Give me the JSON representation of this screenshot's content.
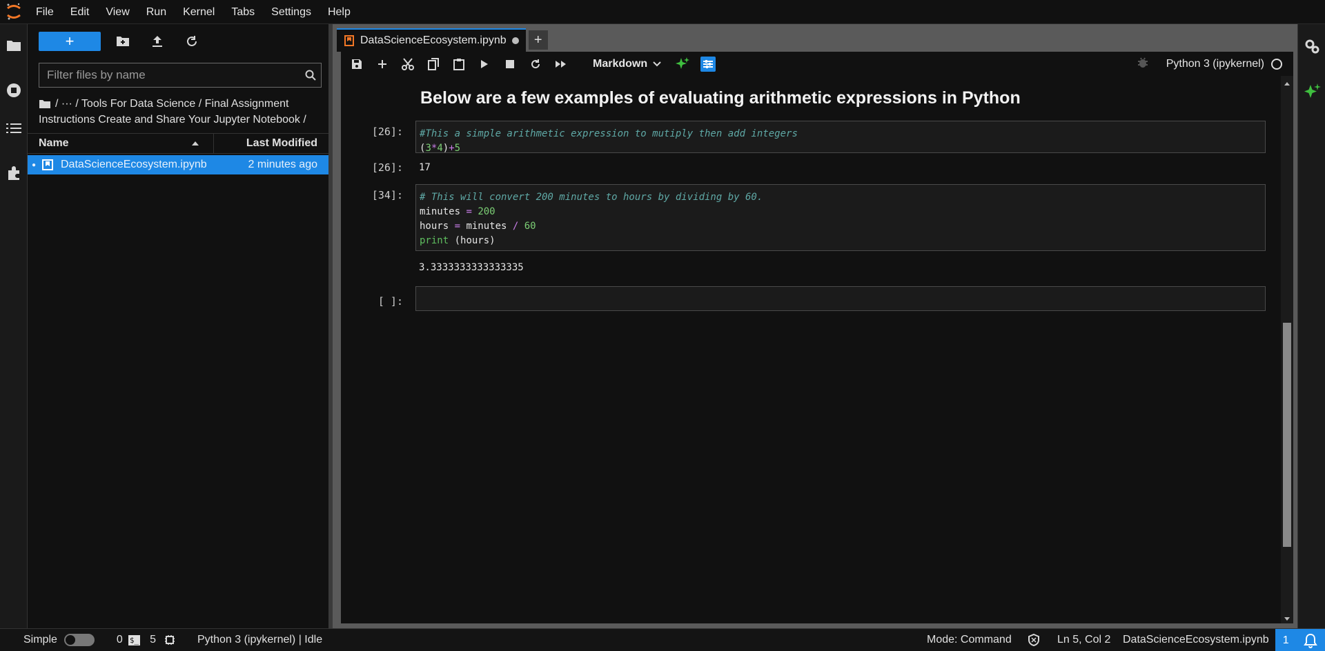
{
  "menu": [
    "File",
    "Edit",
    "View",
    "Run",
    "Kernel",
    "Tabs",
    "Settings",
    "Help"
  ],
  "filebrowser": {
    "new_label": "+",
    "filter_placeholder": "Filter files by name",
    "breadcrumb_line1": "/   ···   / Tools For Data Science / Final Assignment",
    "breadcrumb_line2": "Instructions Create and Share Your Jupyter Notebook /",
    "col_name": "Name",
    "col_modified": "Last Modified",
    "files": [
      {
        "name": "DataScienceEcosystem.ipynb",
        "modified": "2 minutes ago",
        "selected": true
      }
    ]
  },
  "notebook": {
    "tab_title": "DataScienceEcosystem.ipynb",
    "tab_add": "+",
    "cell_type": "Markdown",
    "kernel_name": "Python 3 (ipykernel)",
    "heading": "Below are a few examples of evaluating arithmetic expressions in Python",
    "cells": [
      {
        "prompt": "[26]:",
        "comment": "#This a simple arithmetic expression to mutiply then add integers",
        "code_line2": "(3*4)+5",
        "output_prompt": "[26]:",
        "output": "17"
      },
      {
        "prompt": "[34]:",
        "comment": "# This will convert 200 minutes to hours by dividing by 60.",
        "lines": [
          "minutes = 200",
          "hours = minutes / 60",
          "print (hours)"
        ],
        "output": "3.3333333333333335"
      },
      {
        "prompt": "[ ]:"
      }
    ]
  },
  "status": {
    "mode_toggle_label": "Simple",
    "count_a": "0",
    "terminal_badge": "$_",
    "count_b": "5",
    "kernel_state": "Python 3 (ipykernel) | Idle",
    "mode": "Mode: Command",
    "position": "Ln 5, Col 2",
    "filename": "DataScienceEcosystem.ipynb",
    "notifications": "1"
  },
  "colors": {
    "accent": "#1e88e5",
    "logo": "#f37726",
    "ai_green": "#3fbf3f"
  }
}
